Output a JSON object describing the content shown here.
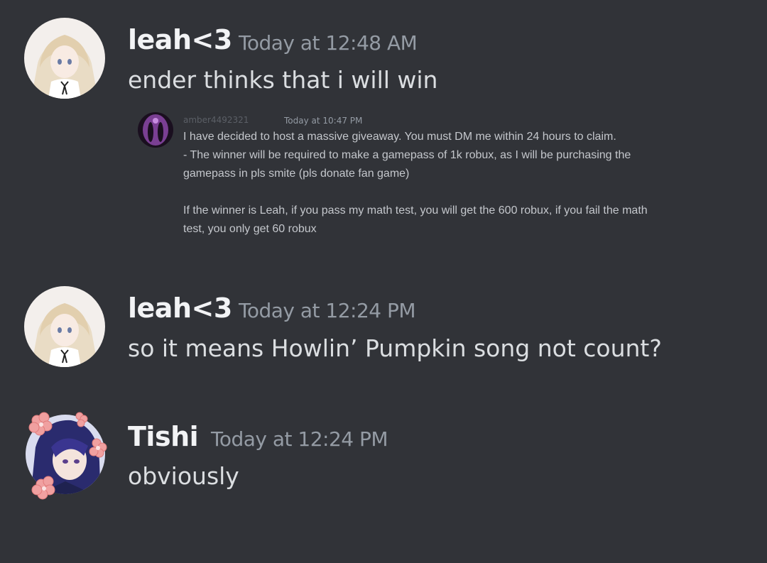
{
  "messages": [
    {
      "author": "leah<3",
      "timestamp": "Today at 12:48 AM",
      "text": "ender thinks that i will win",
      "embed": {
        "author": "amber4492321",
        "timestamp": "Today at 10:47 PM",
        "lines": [
          "I have decided to host a massive giveaway. You must DM me within 24 hours to claim.",
          "- The winner will be required to make a gamepass of 1k robux, as I will be purchasing the",
          "gamepass in pls smite (pls donate fan game)",
          "If the winner is Leah, if you pass my math test, you will get the 600 robux, if you fail the math",
          "test, you only get 60 robux"
        ]
      }
    },
    {
      "author": "leah<3",
      "timestamp": "Today at 12:24 PM",
      "text": "so it means Howlin’ Pumpkin song not count?"
    },
    {
      "author": "Tishi",
      "timestamp": "Today at 12:24 PM",
      "text": "obviously"
    }
  ],
  "colors": {
    "background": "#313338",
    "username": "#f2f3f5",
    "timestamp": "#949ba4",
    "message_text": "#dbdee1",
    "embed_text": "#c4c7cc"
  }
}
